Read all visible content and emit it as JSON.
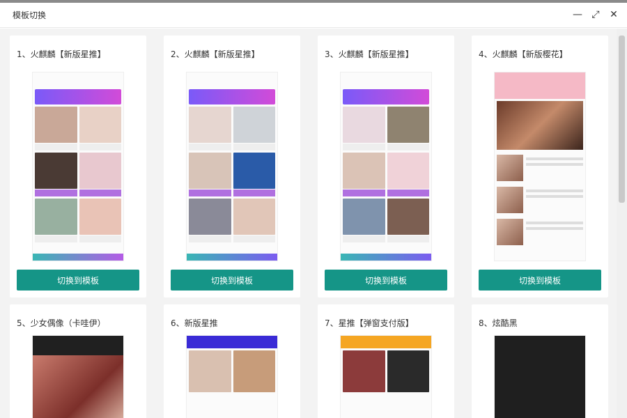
{
  "window": {
    "title": "模板切换"
  },
  "cards": [
    {
      "title": "1、火麒麟【新版星推】",
      "button": "切换到模板"
    },
    {
      "title": "2、火麒麟【新版星推】",
      "button": "切换到模板"
    },
    {
      "title": "3、火麒麟【新版星推】",
      "button": "切换到模板"
    },
    {
      "title": "4、火麒麟【新版樱花】",
      "button": "切换到模板"
    },
    {
      "title": "5、少女偶像（卡哇伊）"
    },
    {
      "title": "6、新版星推"
    },
    {
      "title": "7、星推【弹窗支付版】"
    },
    {
      "title": "8、炫酷黑"
    }
  ],
  "accent_color": "#159587"
}
